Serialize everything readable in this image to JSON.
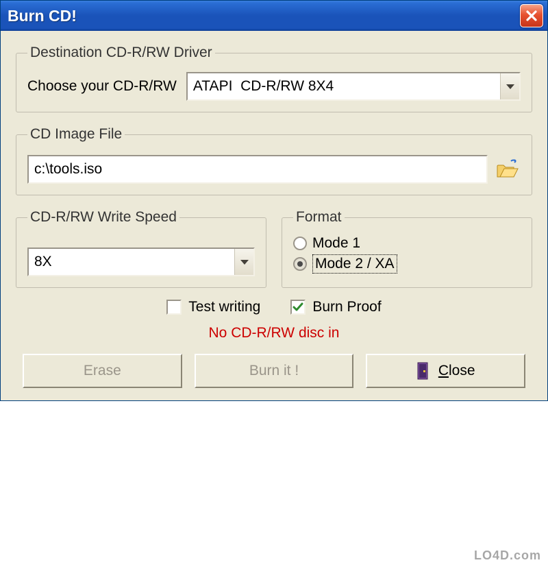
{
  "titlebar": {
    "title": "Burn CD!"
  },
  "driver": {
    "legend": "Destination CD-R/RW Driver",
    "label": "Choose your CD-R/RW",
    "selected": "ATAPI  CD-R/RW 8X4"
  },
  "image": {
    "legend": "CD Image File",
    "path": "c:\\tools.iso"
  },
  "speed": {
    "legend": "CD-R/RW Write Speed",
    "selected": "8X"
  },
  "format": {
    "legend": "Format",
    "option1": "Mode 1",
    "option2": "Mode 2 / XA",
    "selected": "Mode 2 / XA"
  },
  "checks": {
    "test_writing": {
      "label": "Test writing",
      "checked": false
    },
    "burn_proof": {
      "label": "Burn Proof",
      "checked": true
    }
  },
  "status": "No CD-R/RW disc in",
  "buttons": {
    "erase": "Erase",
    "burn": "Burn it !",
    "close": "Close"
  },
  "watermark": "LO4D.com"
}
